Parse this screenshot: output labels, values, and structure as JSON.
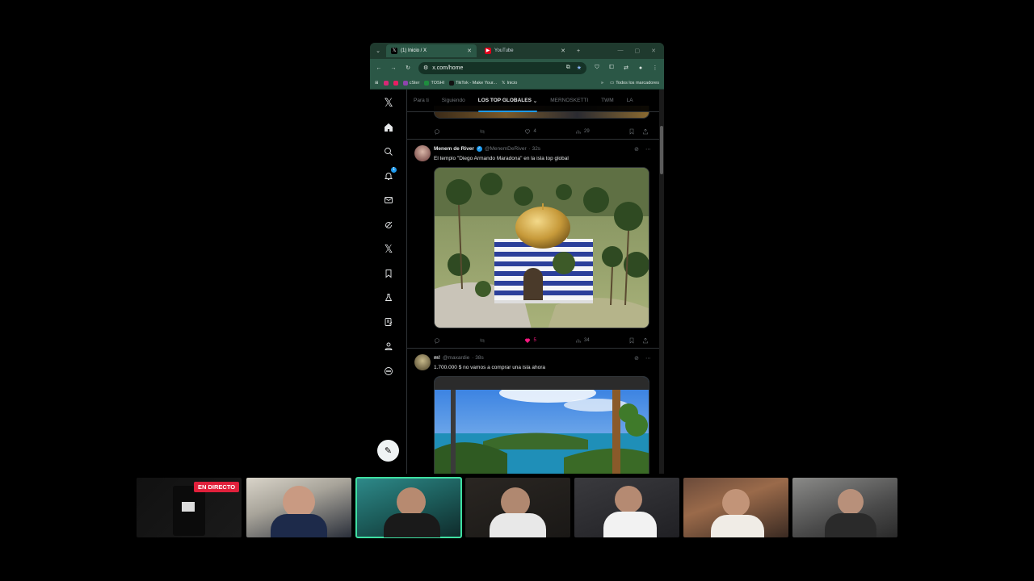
{
  "browser": {
    "tabs": [
      {
        "title": "(1) Inicio / X",
        "icon": "x-logo-icon",
        "active": true
      },
      {
        "title": "YouTube",
        "icon": "youtube-icon",
        "active": false
      }
    ],
    "new_tab": "+",
    "url": "x.com/home",
    "bookmarks": [
      {
        "label": "",
        "icon": "instagram-icon",
        "color": "#d62976"
      },
      {
        "label": "",
        "icon": "app-icon",
        "color": "#e91e63"
      },
      {
        "label": "cSter",
        "icon": "bookmark-icon",
        "color": "#8e44ad"
      },
      {
        "label": "TOSHI",
        "icon": "sheets-icon",
        "color": "#1e8e3e"
      },
      {
        "label": "TikTok - Make Your...",
        "icon": "tiktok-icon",
        "color": "#000000"
      },
      {
        "label": "Inicio",
        "icon": "x-logo-icon",
        "color": "#000000"
      }
    ],
    "bookmarks_overflow": "»",
    "all_bookmarks": "Todos los marcadores"
  },
  "x": {
    "feed_tabs": [
      "Para ti",
      "Siguiendo",
      "LOS TOP GLOBALES",
      "MERNOSKETTI",
      "TWM",
      "LA"
    ],
    "active_feed_tab": "LOS TOP GLOBALES",
    "nav": [
      "x-logo",
      "home",
      "search",
      "notifications",
      "messages",
      "grok",
      "premium",
      "bookmarks",
      "jobs",
      "articles",
      "profile",
      "more"
    ],
    "notification_count": "1",
    "prev_tweet_actions": {
      "replies": "",
      "reposts": "",
      "likes": "4",
      "views": "29"
    },
    "tweets": [
      {
        "name": "Menem de River",
        "verified": true,
        "handle": "@MenemDeRiver",
        "time": "· 32s",
        "text": "El templo \"Diego Armando Maradona\" en la isla top global",
        "actions": {
          "replies": "",
          "reposts": "",
          "likes": "5",
          "views": "34"
        }
      },
      {
        "name": "m!",
        "verified": false,
        "handle": "@maxardie",
        "time": "· 38s",
        "text": "1.700.000 $ no vamos a comprar una isla ahora"
      }
    ]
  },
  "stream": {
    "live_label": "EN DIRECTO",
    "selected_cam": 3,
    "colors": {
      "live": "#e1203b",
      "selected": "#3fe0a2",
      "accent": "#1d9bf0",
      "like": "#f91880"
    }
  }
}
